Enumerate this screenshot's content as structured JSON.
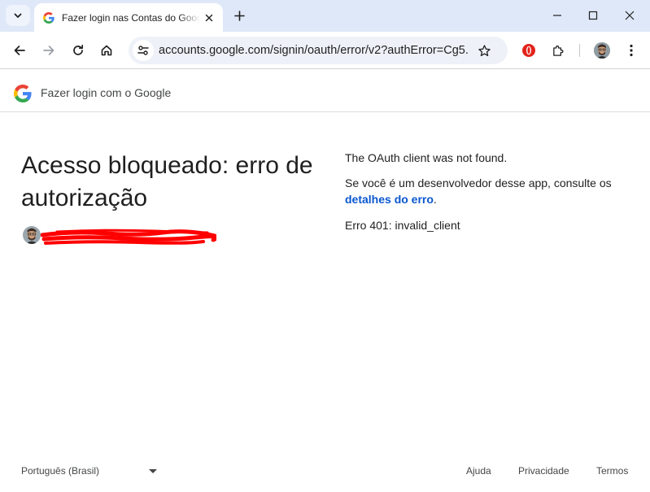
{
  "browser": {
    "tab_title": "Fazer login nas Contas do Google",
    "url": "accounts.google.com/signin/oauth/error/v2?authError=Cg5..."
  },
  "header": {
    "title": "Fazer login com o Google"
  },
  "main": {
    "title": "Acesso bloqueado: erro de autorização",
    "message": "The OAuth client was not found.",
    "developer_text": "Se você é um desenvolvedor desse app, consulte os",
    "details_link": "detalhes do erro",
    "period": ".",
    "error_code": "Erro 401: invalid_client"
  },
  "footer": {
    "language": "Português (Brasil)",
    "help": "Ajuda",
    "privacy": "Privacidade",
    "terms": "Termos"
  },
  "colors": {
    "accent": "#0b57d0",
    "titlebar": "#dfe8f8",
    "omnibox": "#eef1f8"
  },
  "icons": {
    "tab_search": "chevron-down-icon",
    "favicon": "google-g-icon",
    "tab_close": "close-icon",
    "new_tab": "plus-icon",
    "minimize": "minimize-icon",
    "maximize": "maximize-icon",
    "close_window": "close-icon",
    "back": "arrow-left-icon",
    "forward": "arrow-right-icon",
    "reload": "reload-icon",
    "home": "home-icon",
    "site_info": "tune-icon",
    "bookmark": "star-icon",
    "extension_opera": "opera-icon",
    "extensions": "puzzle-icon",
    "profile": "avatar",
    "menu": "kebab-icon"
  }
}
